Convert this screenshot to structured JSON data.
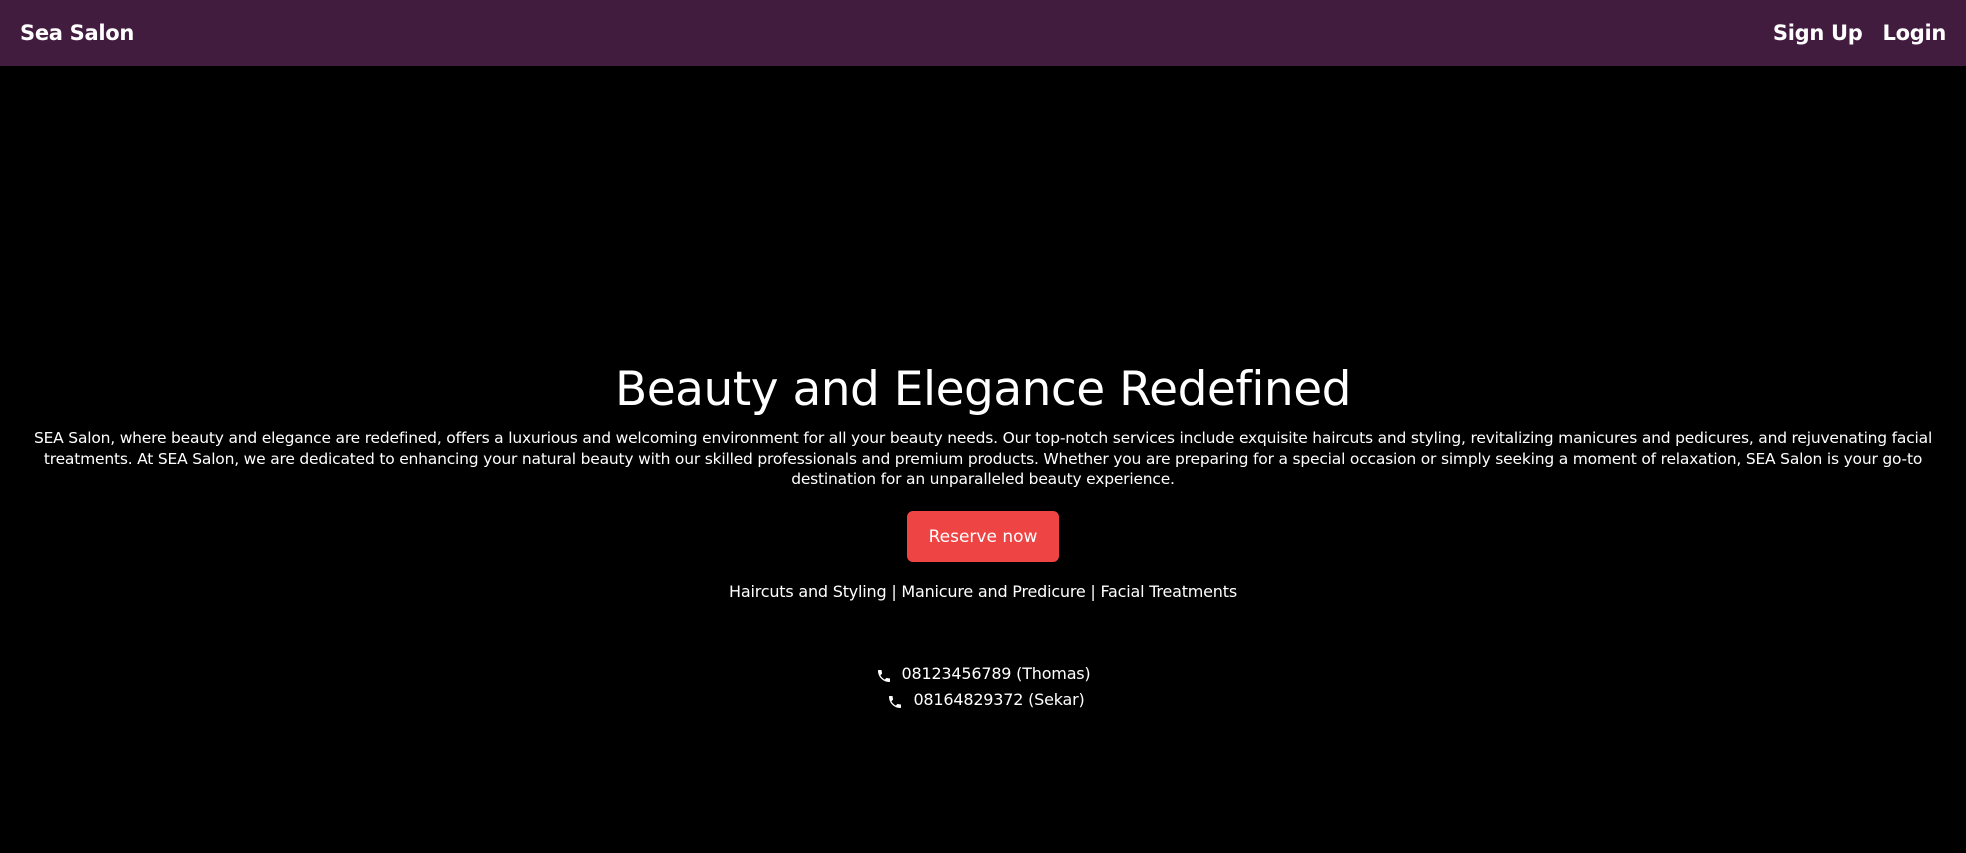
{
  "navbar": {
    "brand": "Sea Salon",
    "links": {
      "signup": "Sign Up",
      "login": "Login"
    },
    "background_color": "#421c3f"
  },
  "hero": {
    "title": "Beauty and Elegance Redefined",
    "description": "SEA Salon, where beauty and elegance are redefined, offers a luxurious and welcoming environment for all your beauty needs. Our top-notch services include exquisite haircuts and styling, revitalizing manicures and pedicures, and rejuvenating facial treatments. At SEA Salon, we are dedicated to enhancing your natural beauty with our skilled professionals and premium products. Whether you are preparing for a special occasion or simply seeking a moment of relaxation, SEA Salon is your go-to destination for an unparalleled beauty experience.",
    "cta_label": "Reserve now",
    "cta_color": "#ef4444",
    "services": "Haircuts and Styling | Manicure and Predicure | Facial Treatments"
  },
  "contacts": [
    {
      "icon": "phone-icon",
      "text": "08123456789 (Thomas)"
    },
    {
      "icon": "phone-icon",
      "text": "08164829372 (Sekar)"
    }
  ]
}
